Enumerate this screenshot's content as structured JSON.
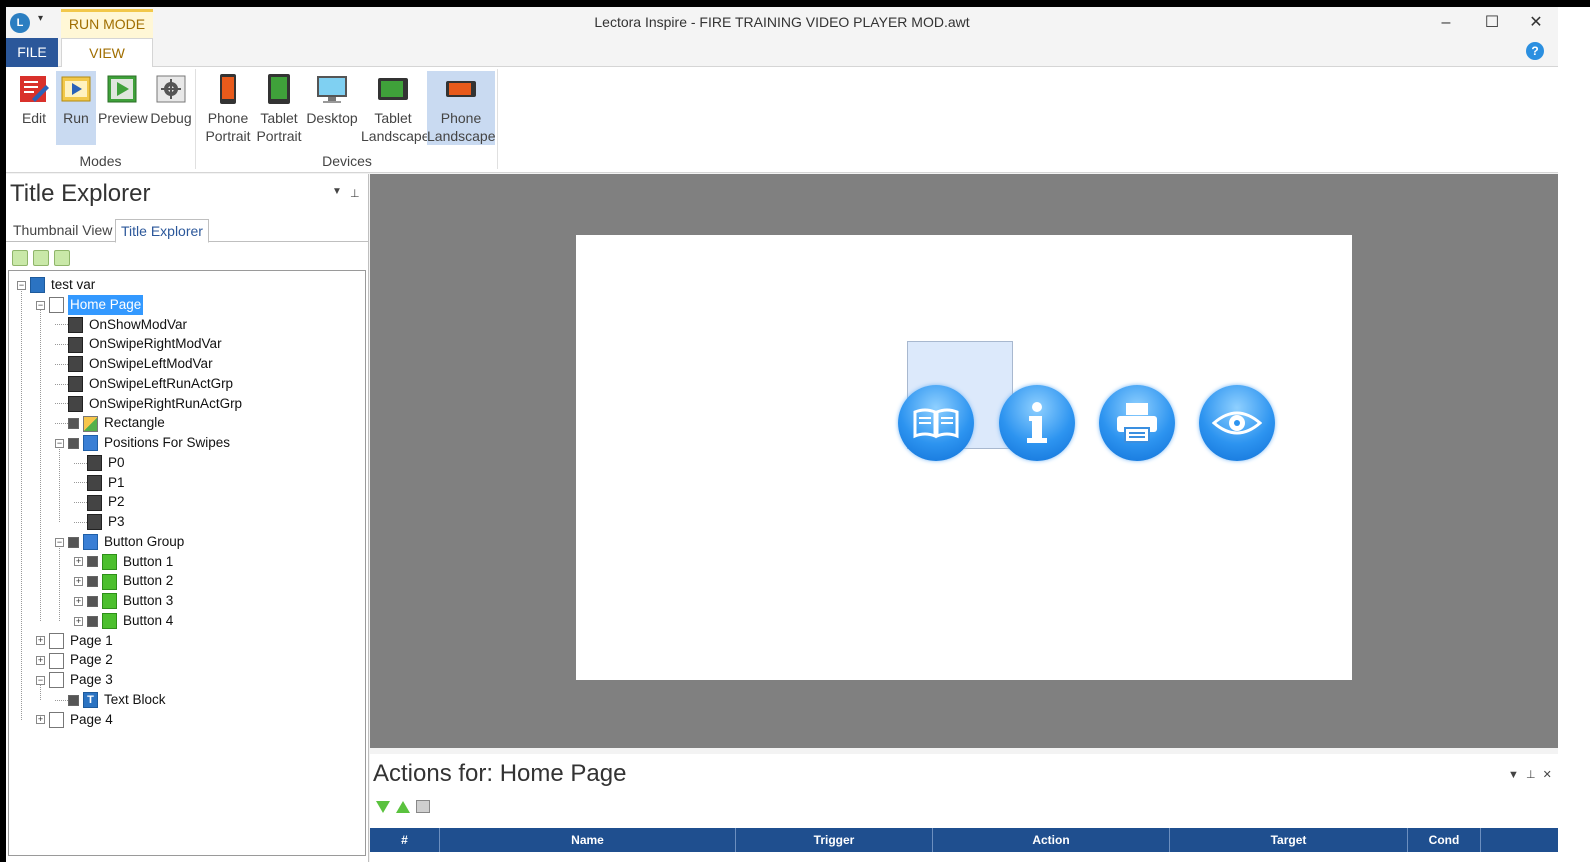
{
  "window": {
    "title": "Lectora Inspire - FIRE TRAINING VIDEO PLAYER MOD.awt",
    "logo": "L",
    "qat_icon": "quick-access-toolbar-icon",
    "minimize": "–",
    "maximize": "☐",
    "close": "✕"
  },
  "ribbon_tabs": {
    "contextual": "RUN MODE",
    "file": "FILE",
    "view": "VIEW",
    "help": "?"
  },
  "ribbon": {
    "groups": [
      {
        "label": "Modes"
      },
      {
        "label": "Devices"
      }
    ],
    "buttons": [
      {
        "label": "Edit",
        "icon": "edit-pencil-icon",
        "color": "#d9312b"
      },
      {
        "label": "Run",
        "icon": "run-icon",
        "color": "#f2c84a"
      },
      {
        "label": "Preview",
        "icon": "preview-play-icon",
        "color": "#3fa13a"
      },
      {
        "label": "Debug",
        "icon": "debug-gear-icon",
        "color": "#777777"
      },
      {
        "label": "Phone",
        "label2": "Portrait",
        "icon": "phone-portrait-icon",
        "color": "#e85a1b"
      },
      {
        "label": "Tablet",
        "label2": "Portrait",
        "icon": "tablet-portrait-icon",
        "color": "#3fa13a"
      },
      {
        "label": "Desktop",
        "icon": "desktop-monitor-icon",
        "color": "#2aa0d8"
      },
      {
        "label": "Tablet",
        "label2": "Landscape",
        "icon": "tablet-landscape-icon",
        "color": "#3fa13a"
      },
      {
        "label": "Phone",
        "label2": "Landscape",
        "icon": "phone-landscape-icon",
        "color": "#e85a1b"
      }
    ]
  },
  "explorer": {
    "title": "Title Explorer",
    "dropdown": "▼",
    "pin": "⊥",
    "tabs": [
      "Thumbnail View",
      "Title Explorer"
    ],
    "tree": [
      {
        "label": "test var",
        "icon": "book",
        "exp": "−"
      },
      {
        "label": "Home Page",
        "icon": "page",
        "exp": "−",
        "selected": true
      },
      {
        "label": "OnShowModVar",
        "icon": "action"
      },
      {
        "label": "OnSwipeRightModVar",
        "icon": "action"
      },
      {
        "label": "OnSwipeLeftModVar",
        "icon": "action"
      },
      {
        "label": "OnSwipeLeftRunActGrp",
        "icon": "action"
      },
      {
        "label": "OnSwipeRightRunActGrp",
        "icon": "action"
      },
      {
        "label": "Rectangle",
        "icon": "shape",
        "chk": true
      },
      {
        "label": "Positions For Swipes",
        "icon": "group",
        "exp": "−",
        "chk": true
      },
      {
        "label": "P0",
        "icon": "action"
      },
      {
        "label": "P1",
        "icon": "action"
      },
      {
        "label": "P2",
        "icon": "action"
      },
      {
        "label": "P3",
        "icon": "action"
      },
      {
        "label": "Button Group",
        "icon": "group",
        "exp": "−",
        "chk": true
      },
      {
        "label": "Button 1",
        "icon": "button",
        "exp": "+",
        "chk": true
      },
      {
        "label": "Button 2",
        "icon": "button",
        "exp": "+",
        "chk": true
      },
      {
        "label": "Button 3",
        "icon": "button",
        "exp": "+",
        "chk": true
      },
      {
        "label": "Button 4",
        "icon": "button",
        "exp": "+",
        "chk": true
      },
      {
        "label": "Page 1",
        "icon": "page",
        "exp": "+"
      },
      {
        "label": "Page 2",
        "icon": "page",
        "exp": "+"
      },
      {
        "label": "Page 3",
        "icon": "page",
        "exp": "−"
      },
      {
        "label": "Text Block",
        "icon": "text",
        "chk": true,
        "icon_text": "T"
      },
      {
        "label": "Page 4",
        "icon": "page",
        "exp": "+"
      }
    ]
  },
  "stage": {
    "buttons": [
      {
        "icon": "book-icon"
      },
      {
        "icon": "info-icon"
      },
      {
        "icon": "printer-icon"
      },
      {
        "icon": "eye-icon"
      }
    ]
  },
  "actions": {
    "title": "Actions for: Home Page",
    "controls": "▼ ⊥ ✕",
    "columns": [
      "#",
      "Name",
      "Trigger",
      "Action",
      "Target",
      "Cond",
      ""
    ]
  }
}
